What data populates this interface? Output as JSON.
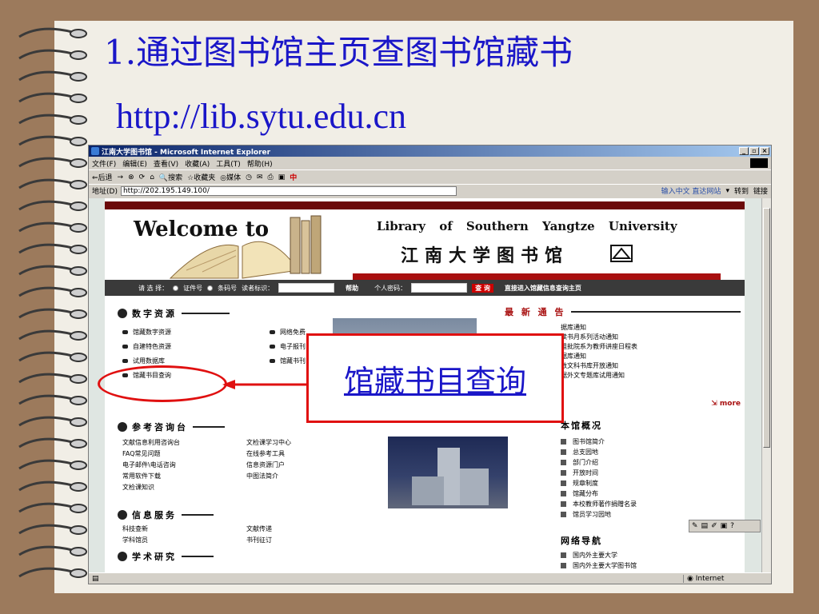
{
  "slide": {
    "title": "1.通过图书馆主页查图书馆藏书",
    "url": "http://lib.sytu.edu.cn",
    "callout_label": "馆藏书目查询"
  },
  "browser": {
    "window_title": "江南大学图书馆 - Microsoft Internet Explorer",
    "menu": [
      "文件(F)",
      "编辑(E)",
      "查看(V)",
      "收藏(A)",
      "工具(T)",
      "帮助(H)"
    ],
    "toolbar": {
      "back": "⇐后退",
      "search": "搜索",
      "favorites": "收藏夹",
      "media": "媒体",
      "zhong": "中"
    },
    "address_label": "地址(D)",
    "address_value": "http://202.195.149.100/",
    "address_hint": "输入中文 直达网站",
    "go_label": "转到",
    "links_label": "链接",
    "status_zone": "Internet"
  },
  "library": {
    "welcome": "Welcome  to",
    "english_name": "Library of Southern Yangtze University",
    "chinese_name": "江南大学图书馆",
    "search": {
      "select_label": "请 选 择：",
      "opt_cert": "证件号",
      "opt_barcode": "条码号",
      "reader_label": "读者标识：",
      "help": "帮助",
      "password_label": "个人密码：",
      "query_button": "查 询",
      "direct_link": "直接进入馆藏信息查询主页"
    },
    "digital": {
      "heading": "数字资源",
      "left": [
        "馆藏数字资源",
        "自建特色资源",
        "试用数据库",
        "馆藏书目查询"
      ],
      "right": [
        "网络免费",
        "电子报刊",
        "馆藏书刊"
      ]
    },
    "notices": {
      "heading": "最 新 通 告",
      "items": [
        "据库通知",
        "读书月系列活动通知",
        "组批院系为教师讲座日程表",
        "据库通知",
        "数文科书库开放通知",
        "据外文专题库试用通知"
      ],
      "more": "more"
    },
    "reference": {
      "heading": "参考咨询台",
      "items": [
        "文献信息利用咨询台",
        "文检课学习中心",
        "FAQ常见问题",
        "在线参考工具",
        "电子邮件\\电话咨询",
        "信息资源门户",
        "常用软件下载",
        "中图法简介",
        "文检课知识",
        ""
      ]
    },
    "info_service": {
      "heading": "信息服务",
      "items": [
        "科技查新",
        "文献传递",
        "学科馆员",
        "书刊征订"
      ]
    },
    "research": {
      "heading": "学术研究"
    },
    "overview": {
      "heading": "本馆概况",
      "items": [
        "图书馆简介",
        "总支园地",
        "部门介绍",
        "开放时间",
        "规章制度",
        "馆藏分布",
        "本校教师著作捐赠名录",
        "馆员学习园地"
      ]
    },
    "nav": {
      "heading": "网络导航",
      "items": [
        "国内外主要大学",
        "国内外主要大学图书馆"
      ]
    }
  },
  "colors": {
    "title_blue": "#1a16c8",
    "callout_red": "#e01010",
    "banner_red": "#a80f0f"
  }
}
